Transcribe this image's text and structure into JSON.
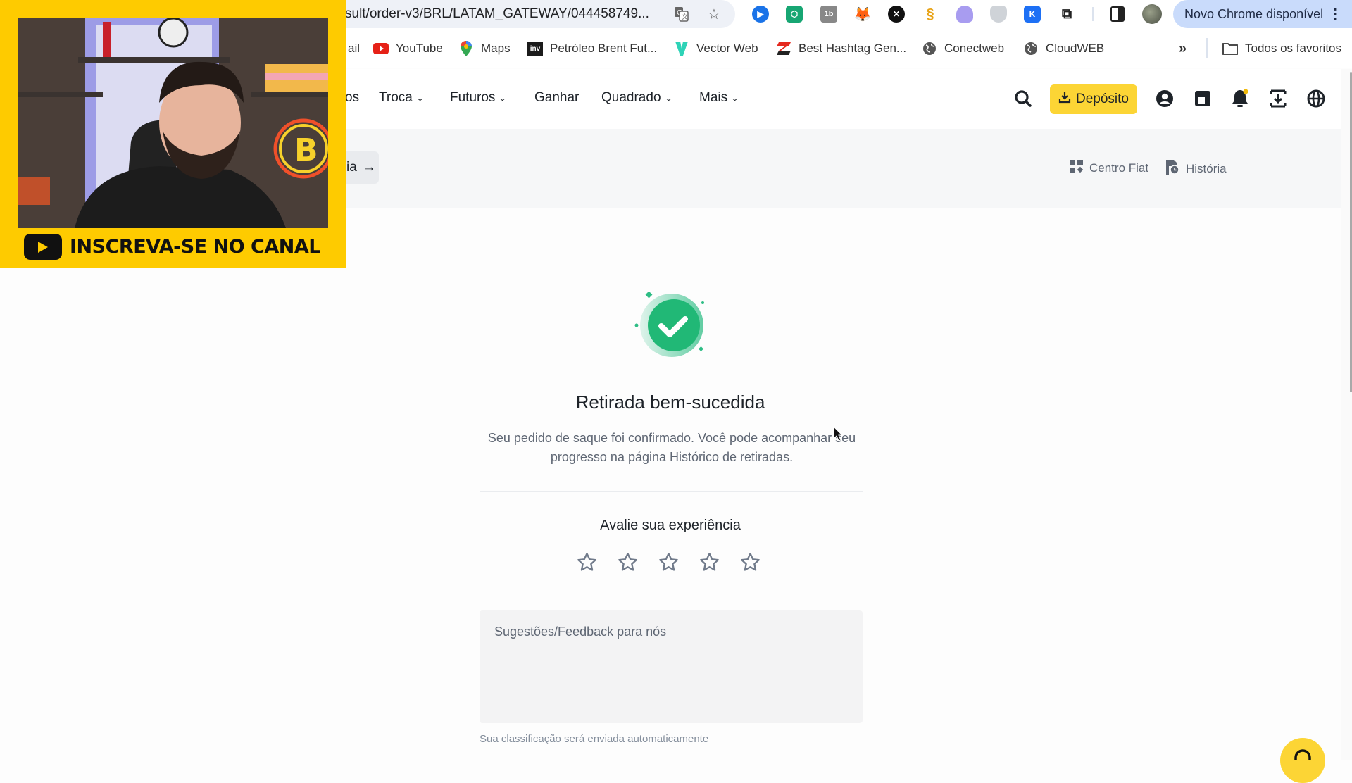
{
  "browser": {
    "url": "sult/order-v3/BRL/LATAM_GATEWAY/044458749...",
    "update_banner": "Novo Chrome disponível",
    "extensions": [
      "extension-blue-play",
      "extension-green-hex",
      "extension-1b",
      "metamask-fox",
      "extension-x",
      "extension-s-chain",
      "extension-ghost",
      "extension-shield",
      "extension-k",
      "extensions-puzzle"
    ],
    "bookmarks": [
      {
        "label": "ail",
        "icon": "gmail-icon"
      },
      {
        "label": "YouTube",
        "icon": "youtube-icon"
      },
      {
        "label": "Maps",
        "icon": "maps-pin-icon"
      },
      {
        "label": "Petróleo Brent Fut...",
        "icon": "investing-icon"
      },
      {
        "label": "Vector Web",
        "icon": "vector-icon"
      },
      {
        "label": "Best Hashtag Gen...",
        "icon": "hashtag-icon"
      },
      {
        "label": "Conectweb",
        "icon": "globe-icon"
      },
      {
        "label": "CloudWEB",
        "icon": "globe-icon"
      }
    ],
    "more_bookmarks": "»",
    "all_bookmarks": "Todos os favoritos"
  },
  "header": {
    "nav": [
      {
        "label": "os",
        "dropdown": false
      },
      {
        "label": "Troca",
        "dropdown": true
      },
      {
        "label": "Futuros",
        "dropdown": true
      },
      {
        "label": "Ganhar",
        "dropdown": false
      },
      {
        "label": "Quadrado",
        "dropdown": true
      },
      {
        "label": "Mais",
        "dropdown": true
      }
    ],
    "deposit_label": "Depósito",
    "accent": "#fcd535"
  },
  "subheader": {
    "back_label": "ia",
    "links": [
      {
        "label": "Centro Fiat",
        "icon": "grid-icon"
      },
      {
        "label": "História",
        "icon": "history-icon"
      }
    ]
  },
  "result": {
    "title": "Retirada bem-sucedida",
    "description": "Seu pedido de saque foi confirmado. Você pode acompanhar seu progresso na página Histórico de retiradas.",
    "success_color": "#2ebd85",
    "rating_title": "Avalie sua experiência",
    "rating": {
      "value": 0,
      "max": 5
    },
    "feedback_placeholder": "Sugestões/Feedback para nós",
    "feedback_value": "",
    "auto_note": "Sua classificação será enviada automaticamente"
  },
  "overlay": {
    "subscribe_label": "INSCREVA-SE NO CANAL",
    "frame_color": "#fecb00"
  }
}
